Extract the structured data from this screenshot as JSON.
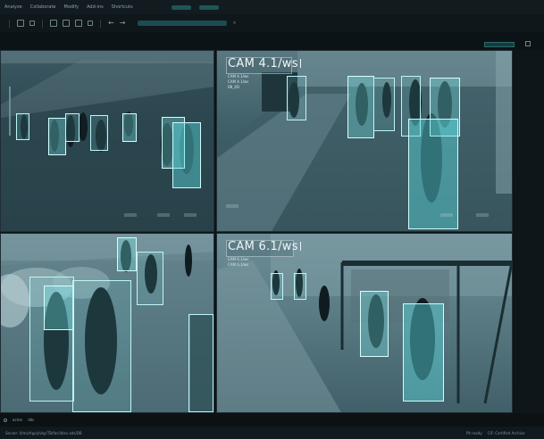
{
  "menu": {
    "items": [
      "Analyze",
      "Collaborate",
      "Modify",
      "Add-ins",
      "Shortcuts"
    ],
    "pills": [
      "",
      ""
    ]
  },
  "cameras": [
    {
      "id": "cam-1",
      "label": "",
      "sub": [],
      "tag": ""
    },
    {
      "id": "cam-4",
      "label": "CAM 4.1/ws",
      "sub": [
        "CAM 4.1/ws",
        "CAM 4.1/ws",
        "0B_4D"
      ],
      "tag": ""
    },
    {
      "id": "cam-3",
      "label": "",
      "sub": [],
      "tag": ""
    },
    {
      "id": "cam-6",
      "label": "CAM 6.1/ws",
      "sub": [
        "CAM 6.1/ws",
        "CAM 6.1/ws"
      ],
      "tag": ""
    }
  ],
  "bottom_bar": {
    "items": [
      "acme",
      "rbb"
    ]
  },
  "status": {
    "path": "Server: 0/ms/ApplyVop/TB/facilities.ads/DB",
    "right": [
      "Pit ready",
      "CIF: Certified Archive"
    ]
  },
  "colors": {
    "detection_box": "#bdf6f6",
    "accent_teal": "#1f5555",
    "chrome": "#0d1418"
  }
}
